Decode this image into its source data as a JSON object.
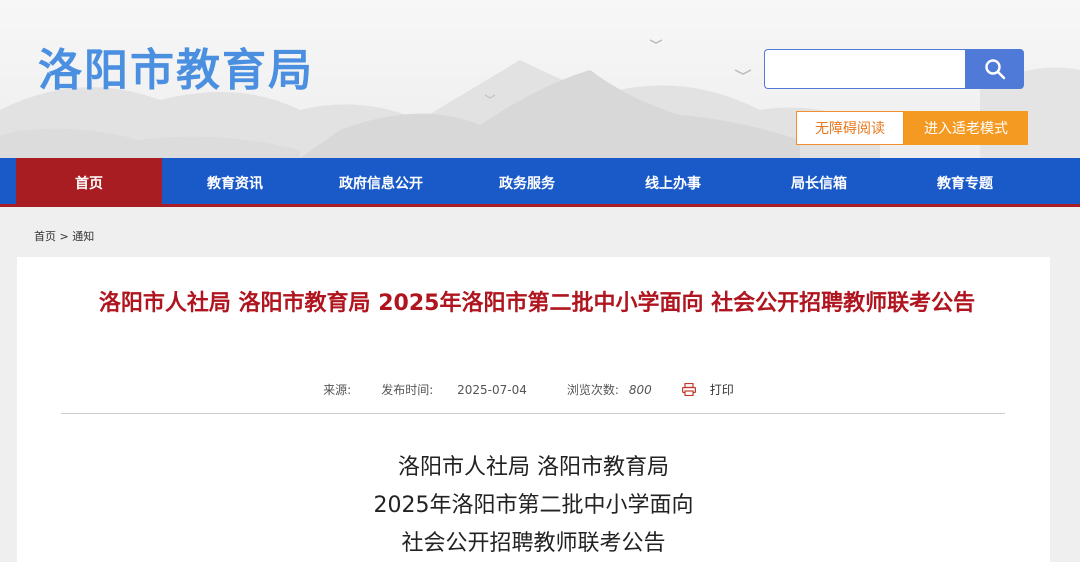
{
  "header": {
    "site_title": "洛阳市教育局",
    "search_placeholder": "",
    "accessible_reading": "无障碍阅读",
    "elder_mode": "进入适老模式"
  },
  "nav": {
    "items": [
      {
        "label": "首页",
        "active": true
      },
      {
        "label": "教育资讯"
      },
      {
        "label": "政府信息公开"
      },
      {
        "label": "政务服务"
      },
      {
        "label": "线上办事"
      },
      {
        "label": "局长信箱"
      },
      {
        "label": "教育专题"
      }
    ]
  },
  "breadcrumb": {
    "home": "首页",
    "sep": ">",
    "current": "通知"
  },
  "article": {
    "title": "洛阳市人社局 洛阳市教育局 2025年洛阳市第二批中小学面向 社会公开招聘教师联考公告",
    "source_label": "来源:",
    "date_label": "发布时间:",
    "date": "2025-07-04",
    "views_label": "浏览次数:",
    "views": "800",
    "print_label": "打印",
    "body_lines": [
      "洛阳市人社局  洛阳市教育局",
      "2025年洛阳市第二批中小学面向",
      "社会公开招聘教师联考公告"
    ]
  },
  "colors": {
    "brand_blue": "#1a5ac8",
    "active_red": "#a81d22",
    "title_red": "#b0151f",
    "orange": "#f49a22"
  }
}
